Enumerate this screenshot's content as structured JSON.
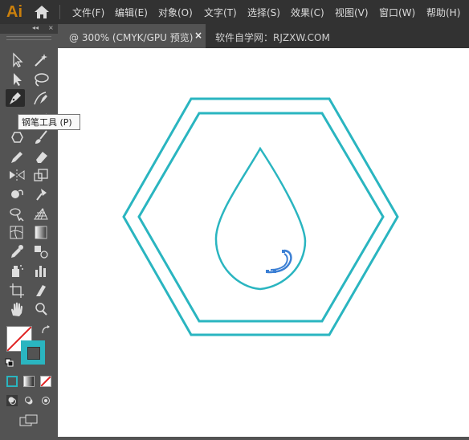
{
  "app": {
    "logo": "Ai"
  },
  "menu": [
    {
      "label": "文件(F)"
    },
    {
      "label": "编辑(E)"
    },
    {
      "label": "对象(O)"
    },
    {
      "label": "文字(T)"
    },
    {
      "label": "选择(S)"
    },
    {
      "label": "效果(C)"
    },
    {
      "label": "视图(V)"
    },
    {
      "label": "窗口(W)"
    },
    {
      "label": "帮助(H)"
    }
  ],
  "tabs": {
    "active_label": "@ 300% (CMYK/GPU 预览)",
    "close_glyph": "×",
    "watermark": "软件自学网：RJZXW.COM"
  },
  "panel": {
    "collapse_glyph": "◂◂",
    "close_glyph": "×"
  },
  "tooltip": {
    "text": "钢笔工具 (P)"
  },
  "colors": {
    "stroke": "#2ab5c0",
    "fill": "none",
    "selection": "#3b7fd4"
  },
  "tools": [
    "selection-tool",
    "direct-selection-tool",
    "magic-wand-tool",
    "lasso-tool",
    "pen-tool",
    "curvature-tool",
    "type-tool",
    "line-segment-tool",
    "rectangle-tool",
    "paintbrush-tool",
    "shaper-tool",
    "eraser-tool",
    "rotate-tool",
    "scale-tool",
    "width-tool",
    "free-transform-tool",
    "shape-builder-tool",
    "perspective-grid-tool",
    "mesh-tool",
    "gradient-tool",
    "eyedropper-tool",
    "blend-tool",
    "symbol-sprayer-tool",
    "column-graph-tool",
    "artboard-tool",
    "slice-tool",
    "hand-tool",
    "zoom-tool"
  ]
}
